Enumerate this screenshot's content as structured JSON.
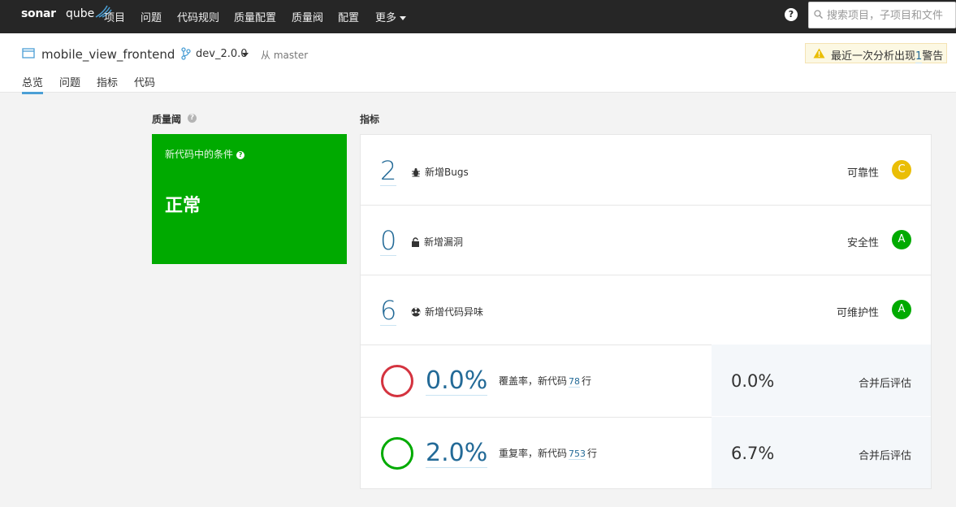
{
  "nav": {
    "logo_sonar": "sonar",
    "logo_qube": "qube",
    "items": [
      "项目",
      "问题",
      "代码规则",
      "质量配置",
      "质量阀",
      "配置"
    ],
    "more": "更多",
    "help": "?",
    "search_placeholder": "搜索项目，子项目和文件"
  },
  "project": {
    "name": "mobile_view_frontend",
    "branch": "dev_2.0.0",
    "from": "从 master",
    "warning_text": "最近一次分析出现",
    "warning_count": "1",
    "warning_suffix": "警告",
    "tabs": [
      "总览",
      "问题",
      "指标",
      "代码"
    ],
    "active_tab": "总览"
  },
  "quality_gate": {
    "title": "质量阈",
    "conditions_label": "新代码中的条件",
    "status": "正常",
    "status_color": "#00aa00"
  },
  "measures": {
    "title": "指标",
    "rows": [
      {
        "value": "2",
        "label": "新增Bugs",
        "icon": "bug-icon",
        "category": "可靠性",
        "rating": "C",
        "rating_color": "#eabe06"
      },
      {
        "value": "0",
        "label": "新增漏洞",
        "icon": "lock-icon",
        "category": "安全性",
        "rating": "A",
        "rating_color": "#00aa00"
      },
      {
        "value": "6",
        "label": "新增代码异味",
        "icon": "code-smell-icon",
        "category": "可维护性",
        "rating": "A",
        "rating_color": "#00aa00"
      }
    ],
    "coverage": {
      "value": "0.0%",
      "label_prefix": "覆盖率，新代码",
      "lines": "78",
      "label_suffix": "行",
      "overall_value": "0.0%",
      "overall_label": "合并后评估",
      "ring_color": "#d4333f"
    },
    "duplication": {
      "value": "2.0%",
      "label_prefix": "重复率，新代码",
      "lines": "753",
      "label_suffix": "行",
      "overall_value": "6.7%",
      "overall_label": "合并后评估",
      "ring_color": "#00aa00"
    }
  }
}
